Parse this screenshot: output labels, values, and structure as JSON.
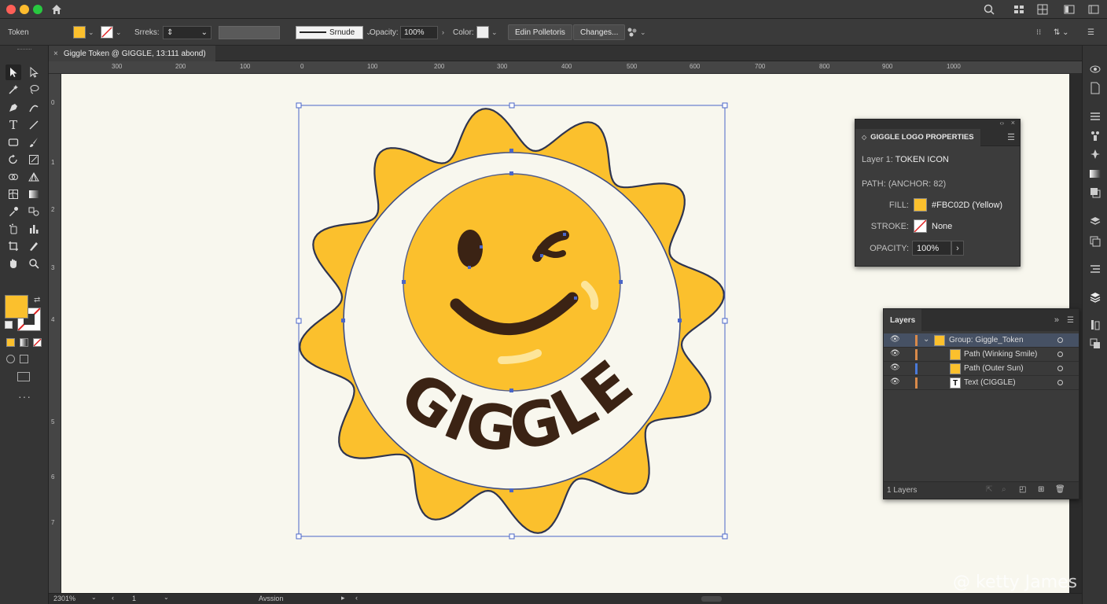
{
  "window": {
    "document_tab": "Giggle Token @ GIGGLE, 13:111 abond)"
  },
  "control_bar": {
    "object_label": "Token",
    "stroke_label": "Srreks:",
    "stroke_style": "Srnude",
    "opacity_label": "Opacity:",
    "opacity_value": "100%",
    "color_label": "Color:",
    "edit_button": "Edin Polletoris",
    "changes_button": "Changes..."
  },
  "ruler": {
    "top_labels": [
      "300",
      "200",
      "100",
      "0",
      "100",
      "200",
      "300",
      "400",
      "500",
      "600",
      "700",
      "800",
      "900",
      "1000"
    ],
    "left_labels": [
      "0",
      "1",
      "2",
      "3",
      "4",
      "5",
      "6",
      "7"
    ]
  },
  "artwork": {
    "text": "GIGGLE",
    "fill_color": "#FBC02D",
    "dark_color": "#3B2314",
    "cream_color": "#F8F7EE"
  },
  "properties_panel": {
    "title": "GIGGLE LOGO PROPERTIES",
    "layer_label": "Layer 1:",
    "layer_value": "TOKEN ICON",
    "path_label": "PATH: (ANCHOR: 82)",
    "fill_label": "FILL:",
    "fill_value": "#FBC02D (Yellow)",
    "stroke_label": "STROKE:",
    "stroke_value": "None",
    "opacity_label": "OPACITY:",
    "opacity_value": "100%"
  },
  "layers_panel": {
    "title": "Layers",
    "rows": [
      {
        "name": "Group: Giggle_Token",
        "color": "#d98a4a"
      },
      {
        "name": "Path (Winking Smile)",
        "color": "#d98a4a"
      },
      {
        "name": "Path (Outer Sun)",
        "color": "#4a7ad9"
      },
      {
        "name": "Text (CIGGLE)",
        "color": "#d98a4a"
      }
    ],
    "footer": "1 Layers"
  },
  "status_bar": {
    "zoom": "2301%",
    "artboard": "1",
    "status": "Avssion"
  },
  "watermark": "@ ketty James"
}
